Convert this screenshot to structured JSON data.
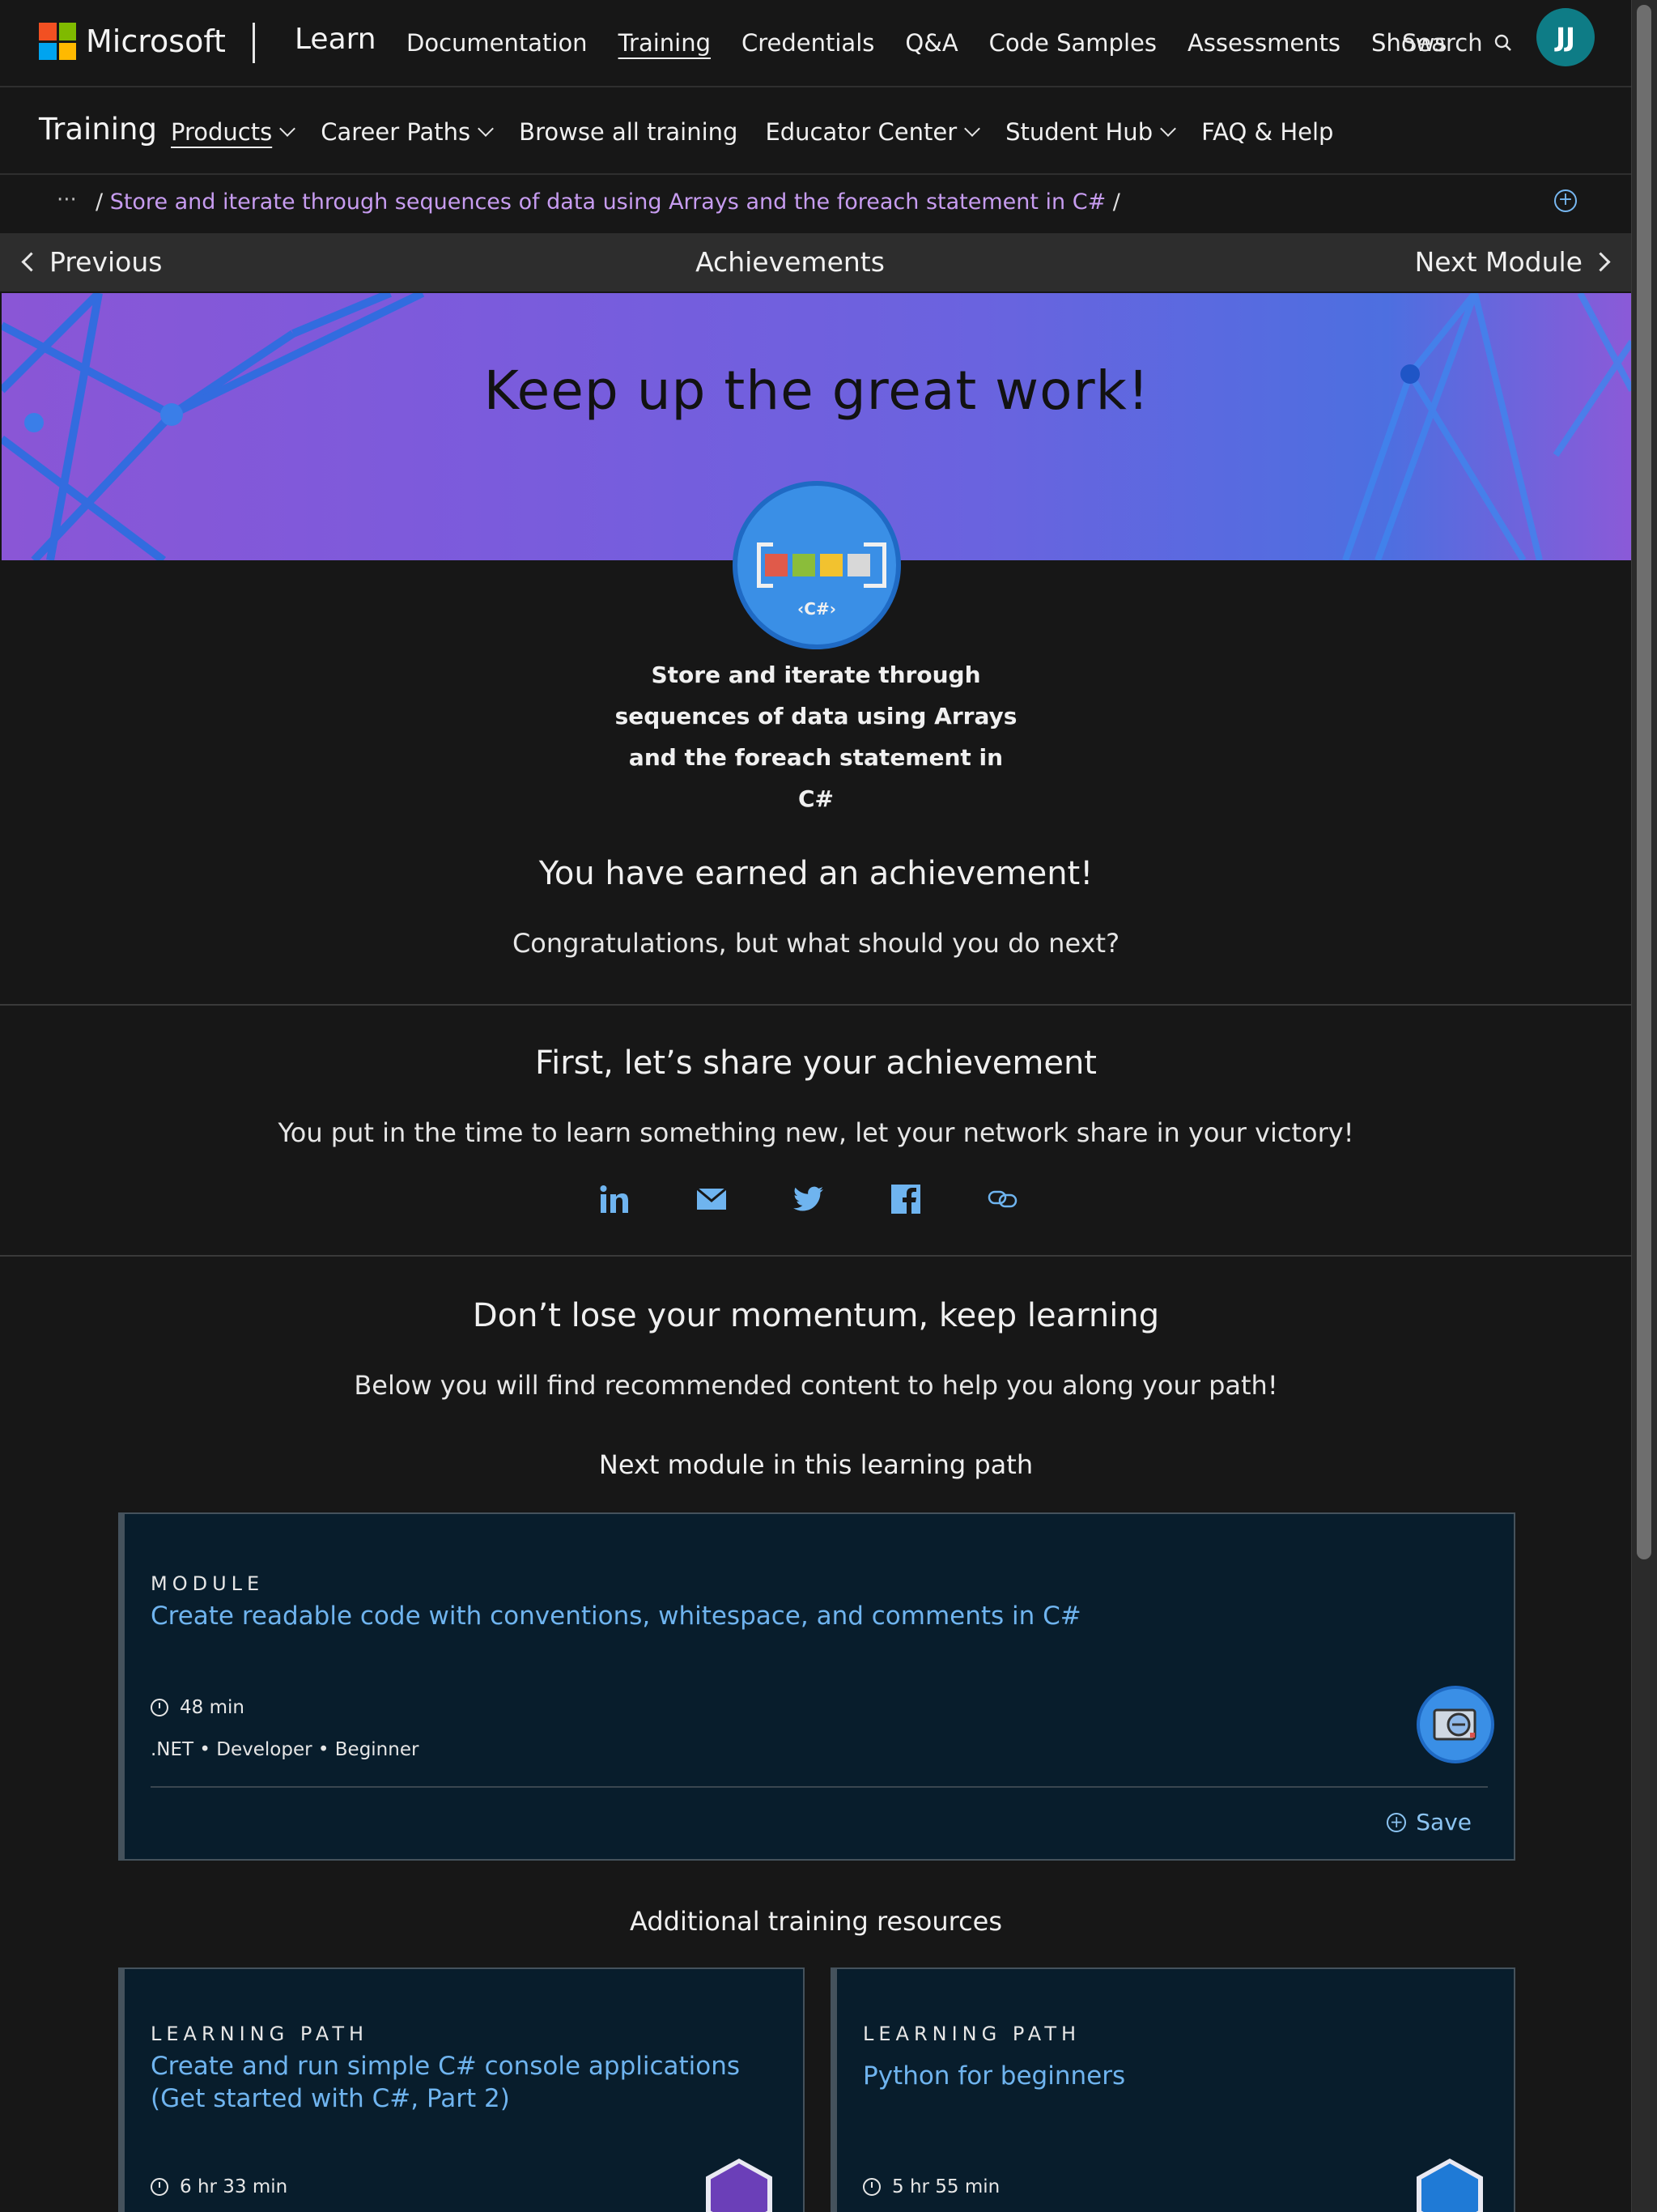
{
  "header": {
    "brand": "Microsoft",
    "product": "Learn",
    "nav": [
      "Documentation",
      "Training",
      "Credentials",
      "Q&A",
      "Code Samples",
      "Assessments",
      "Shows"
    ],
    "active_nav": "Training",
    "search_label": "Search",
    "avatar_initials": "JJ"
  },
  "training_bar": {
    "title": "Training",
    "items": [
      {
        "label": "Products",
        "dropdown": true
      },
      {
        "label": "Career Paths",
        "dropdown": true
      },
      {
        "label": "Browse all training",
        "dropdown": false
      },
      {
        "label": "Educator Center",
        "dropdown": true
      },
      {
        "label": "Student Hub",
        "dropdown": true
      },
      {
        "label": "FAQ & Help",
        "dropdown": false
      }
    ]
  },
  "breadcrumb": {
    "ellipsis": "···",
    "link": "Store and iterate through sequences of data using Arrays and the foreach statement in C#"
  },
  "pager": {
    "previous": "Previous",
    "current": "Achievements",
    "next": "Next Module"
  },
  "hero": {
    "heading": "Keep up the great work!",
    "badge_label": "‹C#›"
  },
  "module_title_lines": [
    "Store and iterate through",
    "sequences of data using Arrays",
    "and the foreach statement in",
    "C#"
  ],
  "achievement": {
    "heading": "You have earned an achievement!",
    "subtext": "Congratulations, but what should you do next?"
  },
  "share": {
    "heading": "First, let’s share your achievement",
    "subtext": "You put in the time to learn something new, let your network share in your victory!",
    "icons": [
      "linkedin-icon",
      "email-icon",
      "twitter-icon",
      "facebook-icon",
      "link-icon"
    ]
  },
  "keep_learning": {
    "heading": "Don’t lose your momentum, keep learning",
    "subtext": "Below you will find recommended content to help you along your path!"
  },
  "next_module": {
    "heading": "Next module in this learning path",
    "kind": "MODULE",
    "title": "Create readable code with conventions, whitespace, and comments in C#",
    "duration": "48 min",
    "tags": ".NET  •  Developer  •  Beginner",
    "save": "Save"
  },
  "additional": {
    "heading": "Additional training resources",
    "cards": [
      {
        "kind": "LEARNING PATH",
        "title": "Create and run simple C# console applications (Get started with C#, Part 2)",
        "duration": "6 hr 33 min"
      },
      {
        "kind": "LEARNING PATH",
        "title": "Python for beginners",
        "duration": "5 hr 55 min"
      }
    ]
  },
  "colors": {
    "background": "#171717",
    "link": "#6fb4ef",
    "breadcrumb_link": "#c79cf0",
    "avatar": "#0e7c86",
    "card_bg": "#081d2c"
  }
}
